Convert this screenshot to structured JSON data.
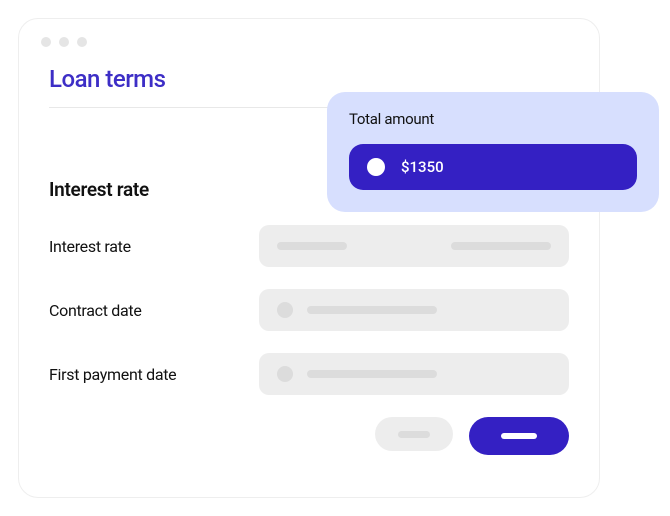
{
  "page": {
    "title": "Loan terms"
  },
  "section": {
    "title": "Interest rate"
  },
  "fields": {
    "interest_rate_label": "Interest rate",
    "contract_date_label": "Contract date",
    "first_payment_date_label": "First payment date"
  },
  "overlay": {
    "title": "Total amount",
    "amount": "$1350"
  }
}
